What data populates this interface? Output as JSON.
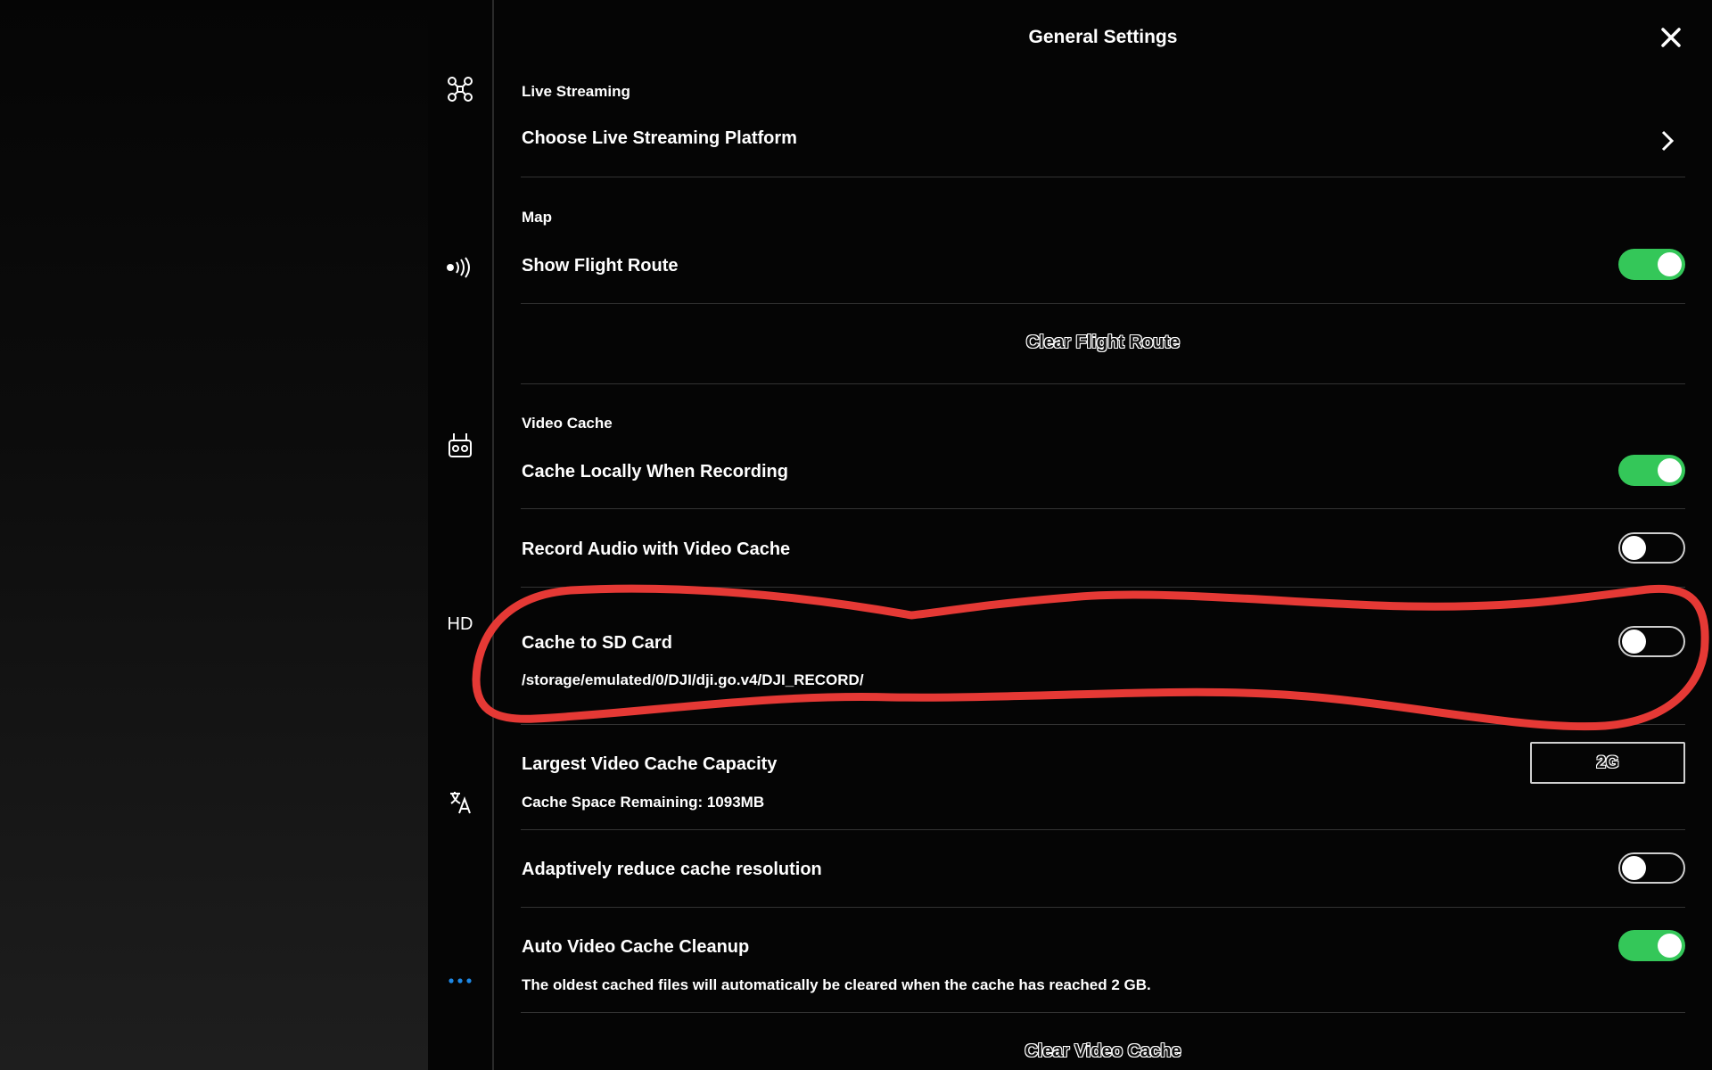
{
  "header": {
    "title": "General Settings"
  },
  "rail": {
    "hd_label": "HD"
  },
  "live_streaming": {
    "section": "Live Streaming",
    "choose_platform": "Choose Live Streaming Platform"
  },
  "map": {
    "section": "Map",
    "show_flight_route": "Show Flight Route",
    "show_flight_route_on": true,
    "clear_flight_route": "Clear Flight Route"
  },
  "video_cache": {
    "section": "Video Cache",
    "cache_locally": "Cache Locally When Recording",
    "cache_locally_on": true,
    "record_audio": "Record Audio with Video Cache",
    "record_audio_on": false,
    "cache_sd": "Cache to SD Card",
    "cache_sd_on": false,
    "cache_path": "/storage/emulated/0/DJI/dji.go.v4/DJI_RECORD/",
    "largest_capacity": "Largest Video Cache Capacity",
    "capacity_value": "2G",
    "space_remaining": "Cache Space Remaining: 1093MB",
    "adaptive_reduce": "Adaptively reduce cache resolution",
    "adaptive_reduce_on": false,
    "auto_cleanup": "Auto Video Cache Cleanup",
    "auto_cleanup_on": true,
    "auto_cleanup_desc": "The oldest cached files will automatically be cleared when the cache has reached 2 GB.",
    "clear_cache": "Clear Video Cache"
  },
  "colors": {
    "toggle_on": "#34c759",
    "annotation": "#e53935",
    "rail_active": "#1e88e5"
  }
}
